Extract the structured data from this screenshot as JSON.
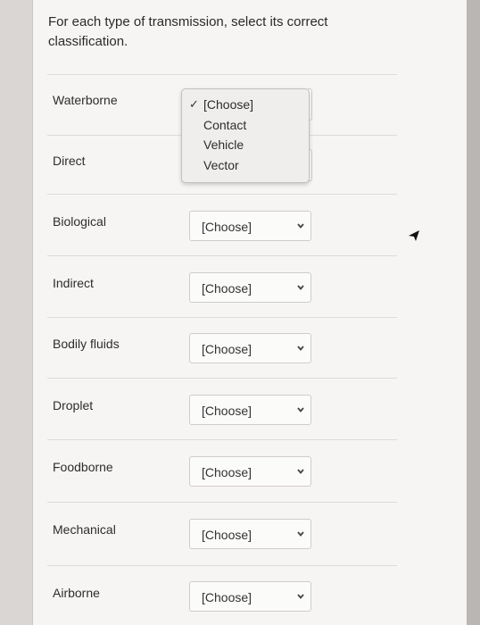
{
  "question": "For each type of transmission, select its correct classification.",
  "dropdown": {
    "options": [
      "[Choose]",
      "Contact",
      "Vehicle",
      "Vector"
    ],
    "checked_index": 0,
    "check_glyph": "✓"
  },
  "rows": [
    {
      "label": "Waterborne",
      "selected": "[Choose]"
    },
    {
      "label": "Direct",
      "selected": "[Choose]"
    },
    {
      "label": "Biological",
      "selected": "[Choose]"
    },
    {
      "label": "Indirect",
      "selected": "[Choose]"
    },
    {
      "label": "Bodily fluids",
      "selected": "[Choose]"
    },
    {
      "label": "Droplet",
      "selected": "[Choose]"
    },
    {
      "label": "Foodborne",
      "selected": "[Choose]"
    },
    {
      "label": "Mechanical",
      "selected": "[Choose]"
    },
    {
      "label": "Airborne",
      "selected": "[Choose]"
    }
  ],
  "icons": {
    "chevron": "chevron-down-icon",
    "cursor": "mouse-pointer-icon"
  },
  "colors": {
    "page_bg": "#f6f5f3",
    "outer_bg": "#d9d6d3",
    "text": "#2d2d2d"
  }
}
